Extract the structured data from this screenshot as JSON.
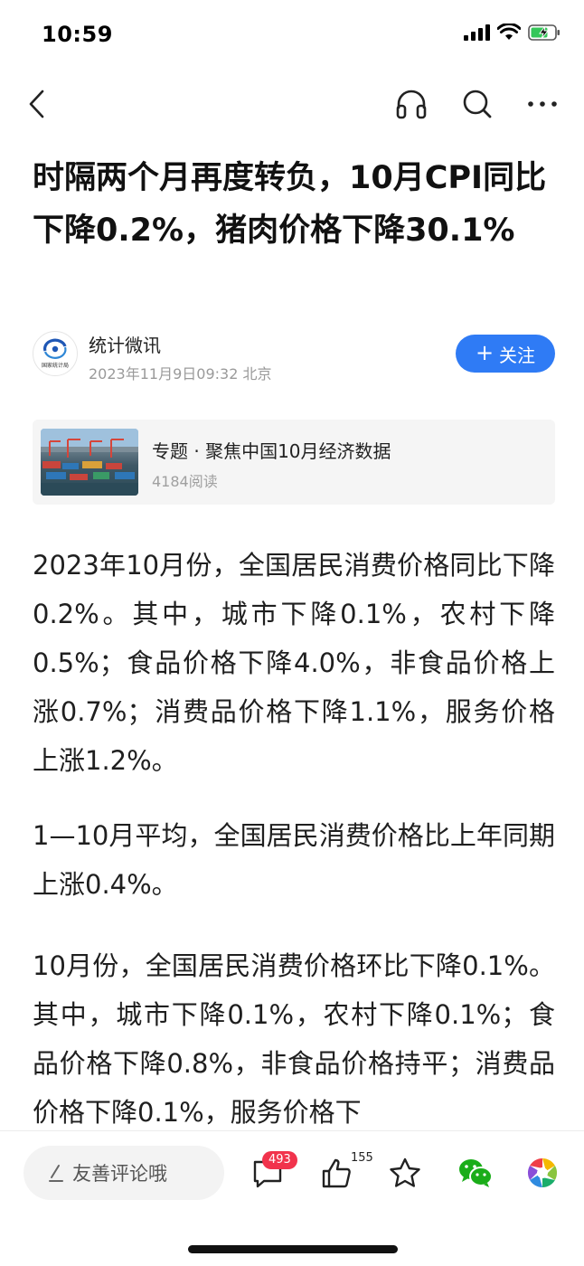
{
  "status_bar": {
    "time": "10:59",
    "icons": [
      "signal-icon",
      "wifi-icon",
      "battery-charging-icon"
    ]
  },
  "nav": {
    "icons": [
      "back-icon",
      "headphones-icon",
      "search-icon",
      "more-icon"
    ]
  },
  "article": {
    "title": "时隔两个月再度转负，10月CPI同比下降0.2%，猪肉价格下降30.1%",
    "author": {
      "name": "统计微讯",
      "meta": "2023年11月9日09:32 北京",
      "avatar_text": "国家统计局",
      "follow_label": "关注"
    },
    "topic": {
      "title": "专题 · 聚焦中国10月经济数据",
      "reads": "4184阅读"
    },
    "paragraphs": [
      "2023年10月份，全国居民消费价格同比下降0.2%。其中，城市下降0.1%，农村下降0.5%；食品价格下降4.0%，非食品价格上涨0.7%；消费品价格下降1.1%，服务价格上涨1.2%。",
      "1—10月平均，全国居民消费价格比上年同期上涨0.4%。",
      "10月份，全国居民消费价格环比下降0.1%。其中，城市下降0.1%，农村下降0.1%；食品价格下降0.8%，非食品价格持平；消费品价格下降0.1%，服务价格下"
    ]
  },
  "bottom_bar": {
    "comment_placeholder": "友善评论哦",
    "comment_count": "493",
    "like_count": "155"
  },
  "colors": {
    "accent": "#2f7bf5",
    "badge": "#f1334c",
    "wechat": "#1aad19"
  }
}
